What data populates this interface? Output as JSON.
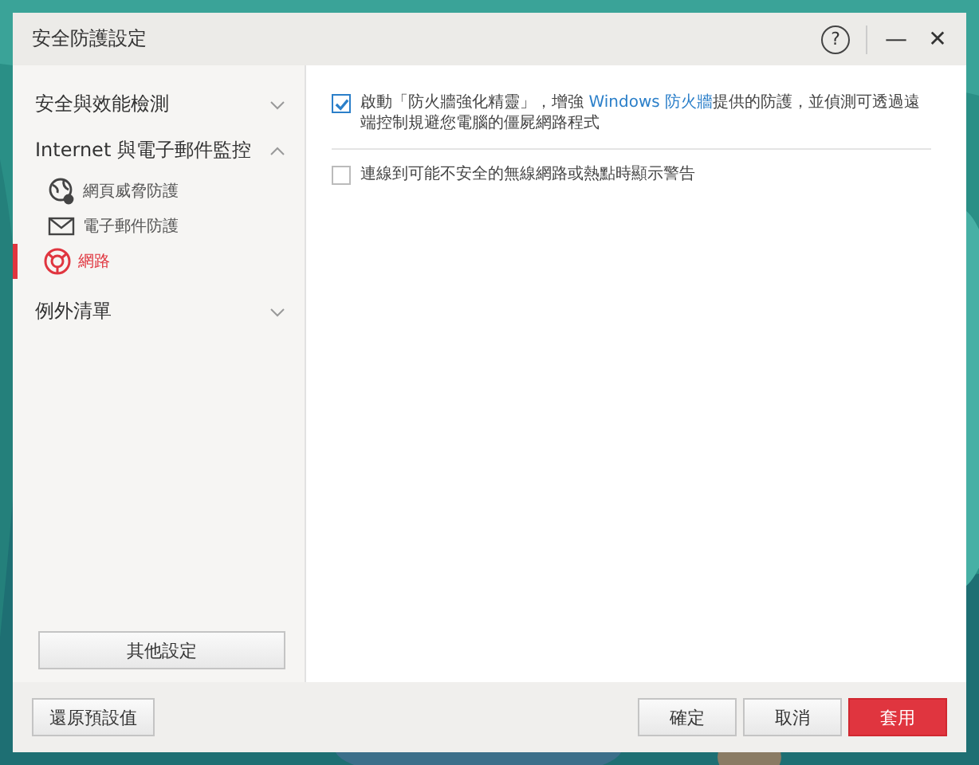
{
  "window": {
    "title": "安全防護設定",
    "controls": [
      "?",
      "—",
      "✕"
    ]
  },
  "sidebar": {
    "groups": [
      {
        "label": "安全與效能檢測",
        "expanded": false
      },
      {
        "label": "Internet 與電子郵件監控",
        "expanded": true,
        "children": [
          {
            "label": "網頁威脅防護",
            "kind": "globe",
            "selected": false
          },
          {
            "label": "電子郵件防護",
            "kind": "mail",
            "selected": false
          },
          {
            "label": "網路",
            "kind": "network",
            "selected": true
          }
        ]
      },
      {
        "label": "例外清單",
        "expanded": false
      }
    ],
    "button": "其他設定"
  },
  "options": [
    {
      "checked": true,
      "parts": [
        {
          "kind": "text",
          "text": "啟動「防火牆強化精靈」，增強 "
        },
        {
          "kind": "link",
          "text": "Windows 防火牆"
        },
        {
          "kind": "text",
          "text": "提供的防護，並偵測可透過遠端控制規避您電腦的僵屍網路程式"
        }
      ]
    },
    {
      "checked": false,
      "parts": [
        {
          "kind": "text",
          "text": "連線到可能不安全的無線網路或熱點時顯示警告"
        }
      ]
    }
  ],
  "footer": {
    "reset": "還原預設值",
    "buttons": [
      {
        "label": "確定",
        "kind": "normal"
      },
      {
        "label": "取消",
        "kind": "normal"
      },
      {
        "label": "套用",
        "kind": "primary"
      }
    ]
  }
}
